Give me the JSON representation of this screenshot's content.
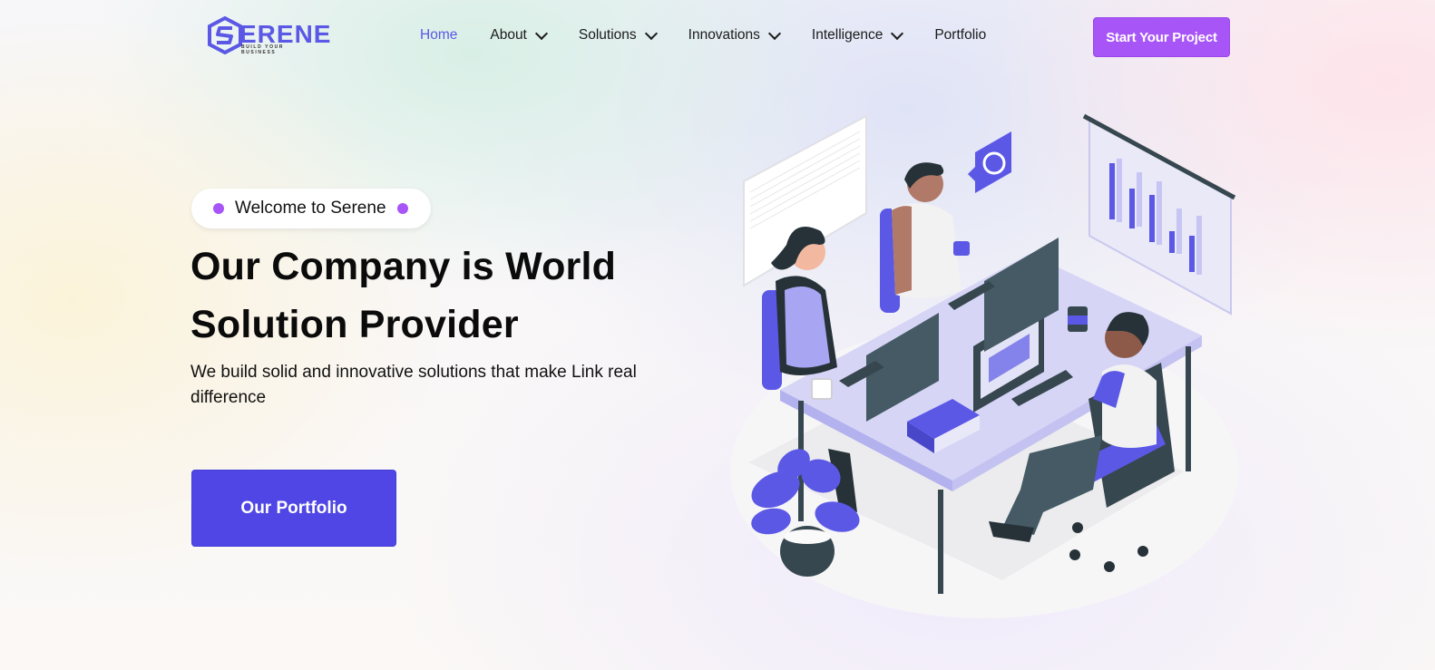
{
  "brand": {
    "name": "ERENE",
    "tagline": "BUILD YOUR BUSINESS",
    "accent": "#5b58e6"
  },
  "nav": {
    "items": [
      {
        "label": "Home",
        "active": true,
        "dropdown": false
      },
      {
        "label": "About",
        "active": false,
        "dropdown": true
      },
      {
        "label": "Solutions",
        "active": false,
        "dropdown": true
      },
      {
        "label": "Innovations",
        "active": false,
        "dropdown": true
      },
      {
        "label": "Intelligence",
        "active": false,
        "dropdown": true
      },
      {
        "label": "Portfolio",
        "active": false,
        "dropdown": false
      }
    ],
    "cta_label": "Start Your Project",
    "cta_color": "#a855f7"
  },
  "hero": {
    "badge": "Welcome to Serene",
    "headline_line1": "Our Company is World",
    "headline_line2": "Solution Provider",
    "subtitle": "We build solid and innovative solutions that make Link real difference",
    "button_label": "Our Portfolio",
    "button_color": "#4f46e5"
  },
  "illustration": {
    "icon": "office-team-illustration"
  }
}
